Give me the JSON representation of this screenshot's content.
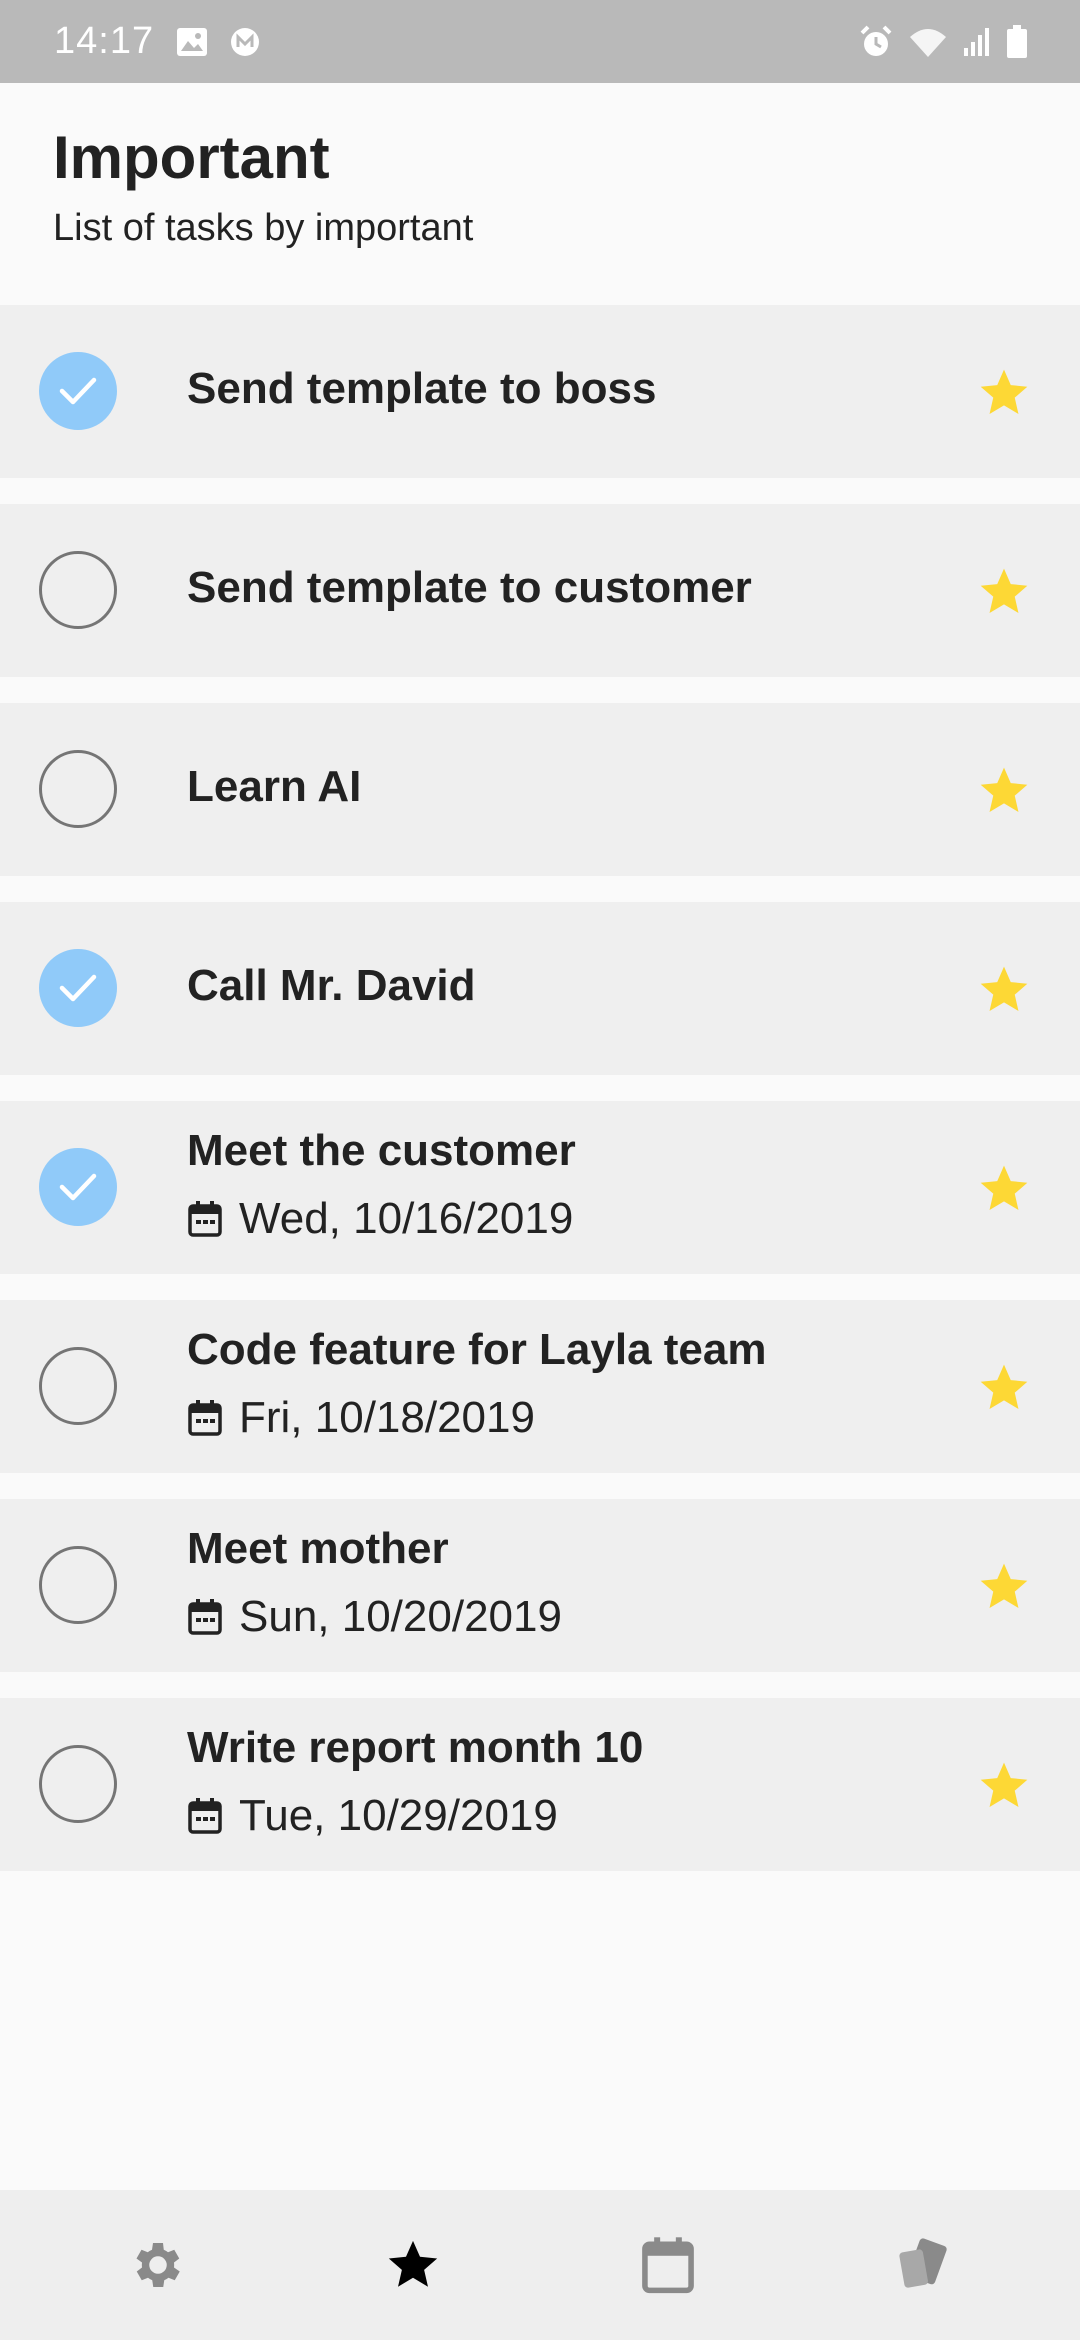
{
  "status_bar": {
    "time": "14:17",
    "icons": [
      "image-icon",
      "m-notification-icon",
      "alarm-icon",
      "wifi-icon",
      "signal-icon",
      "battery-icon"
    ]
  },
  "header": {
    "title": "Important",
    "subtitle": "List of tasks by important"
  },
  "tasks": [
    {
      "title": "Send template to boss",
      "date": "",
      "completed": true,
      "important": true
    },
    {
      "title": "Send template to customer",
      "date": "",
      "completed": false,
      "important": true
    },
    {
      "title": "Learn AI",
      "date": "",
      "completed": false,
      "important": true
    },
    {
      "title": "Call Mr. David",
      "date": "",
      "completed": true,
      "important": true
    },
    {
      "title": "Meet the customer",
      "date": "Wed, 10/16/2019",
      "completed": true,
      "important": true
    },
    {
      "title": "Code feature for Layla team",
      "date": "Fri, 10/18/2019",
      "completed": false,
      "important": true
    },
    {
      "title": "Meet mother",
      "date": "Sun, 10/20/2019",
      "completed": false,
      "important": true
    },
    {
      "title": "Write report month 10",
      "date": "Tue, 10/29/2019",
      "completed": false,
      "important": true
    }
  ],
  "bottom_nav": [
    {
      "name": "settings",
      "icon": "gear-icon",
      "active": false
    },
    {
      "name": "important",
      "icon": "star-icon",
      "active": true
    },
    {
      "name": "calendar",
      "icon": "calendar-icon",
      "active": false
    },
    {
      "name": "categories",
      "icon": "cards-icon",
      "active": false
    }
  ],
  "colors": {
    "status_bar_bg": "#b9b9b9",
    "row_bg": "#efefef",
    "check_done": "#90caf9",
    "star": "#fdd835",
    "nav_bg": "#eeeeee",
    "nav_active": "#000000",
    "nav_inactive": "#8a8a8a"
  }
}
